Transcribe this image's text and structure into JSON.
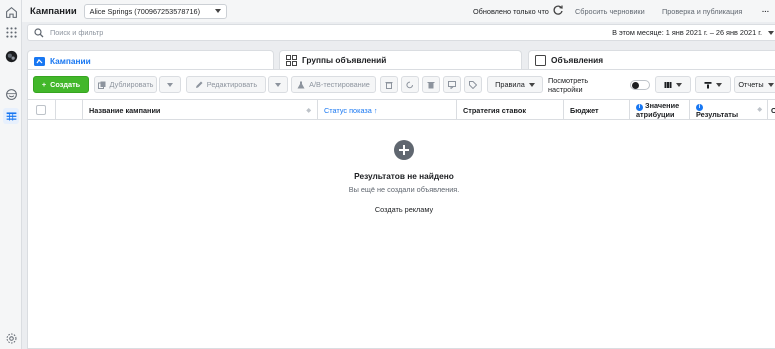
{
  "header": {
    "title": "Кампании",
    "account": "Alice Springs (700967253578716)",
    "status": "Обновлено только что",
    "discard_drafts": "Сбросить черновики",
    "review_publish": "Проверка и публикация",
    "more": "···"
  },
  "search": {
    "placeholder": "Поиск и фильтр",
    "date_range": "В этом месяце: 1 янв 2021 г. – 26 янв 2021 г."
  },
  "tabs": [
    {
      "label": "Кампании"
    },
    {
      "label": "Группы объявлений"
    },
    {
      "label": "Объявления"
    }
  ],
  "toolbar": {
    "create": "Создать",
    "duplicate": "Дублировать",
    "edit": "Редактировать",
    "ab_test": "A/B-тестирование",
    "rules": "Правила",
    "view_setup_line1": "Посмотреть",
    "view_setup_line2": "настройки",
    "reports": "Отчеты"
  },
  "table": {
    "columns": {
      "name": "Название кампании",
      "delivery": "Статус показа ↑",
      "bid": "Стратегия ставок",
      "budget": "Бюджет",
      "attribution_line1": "Значение",
      "attribution_line2": "атрибуции",
      "results": "Результаты",
      "cut": "О"
    }
  },
  "empty_state": {
    "title": "Результатов не найдено",
    "subtitle": "Вы ещё не создали объявления.",
    "action": "Создать рекламу"
  },
  "colors": {
    "accent": "#1877f2",
    "create_green": "#42b72a"
  }
}
